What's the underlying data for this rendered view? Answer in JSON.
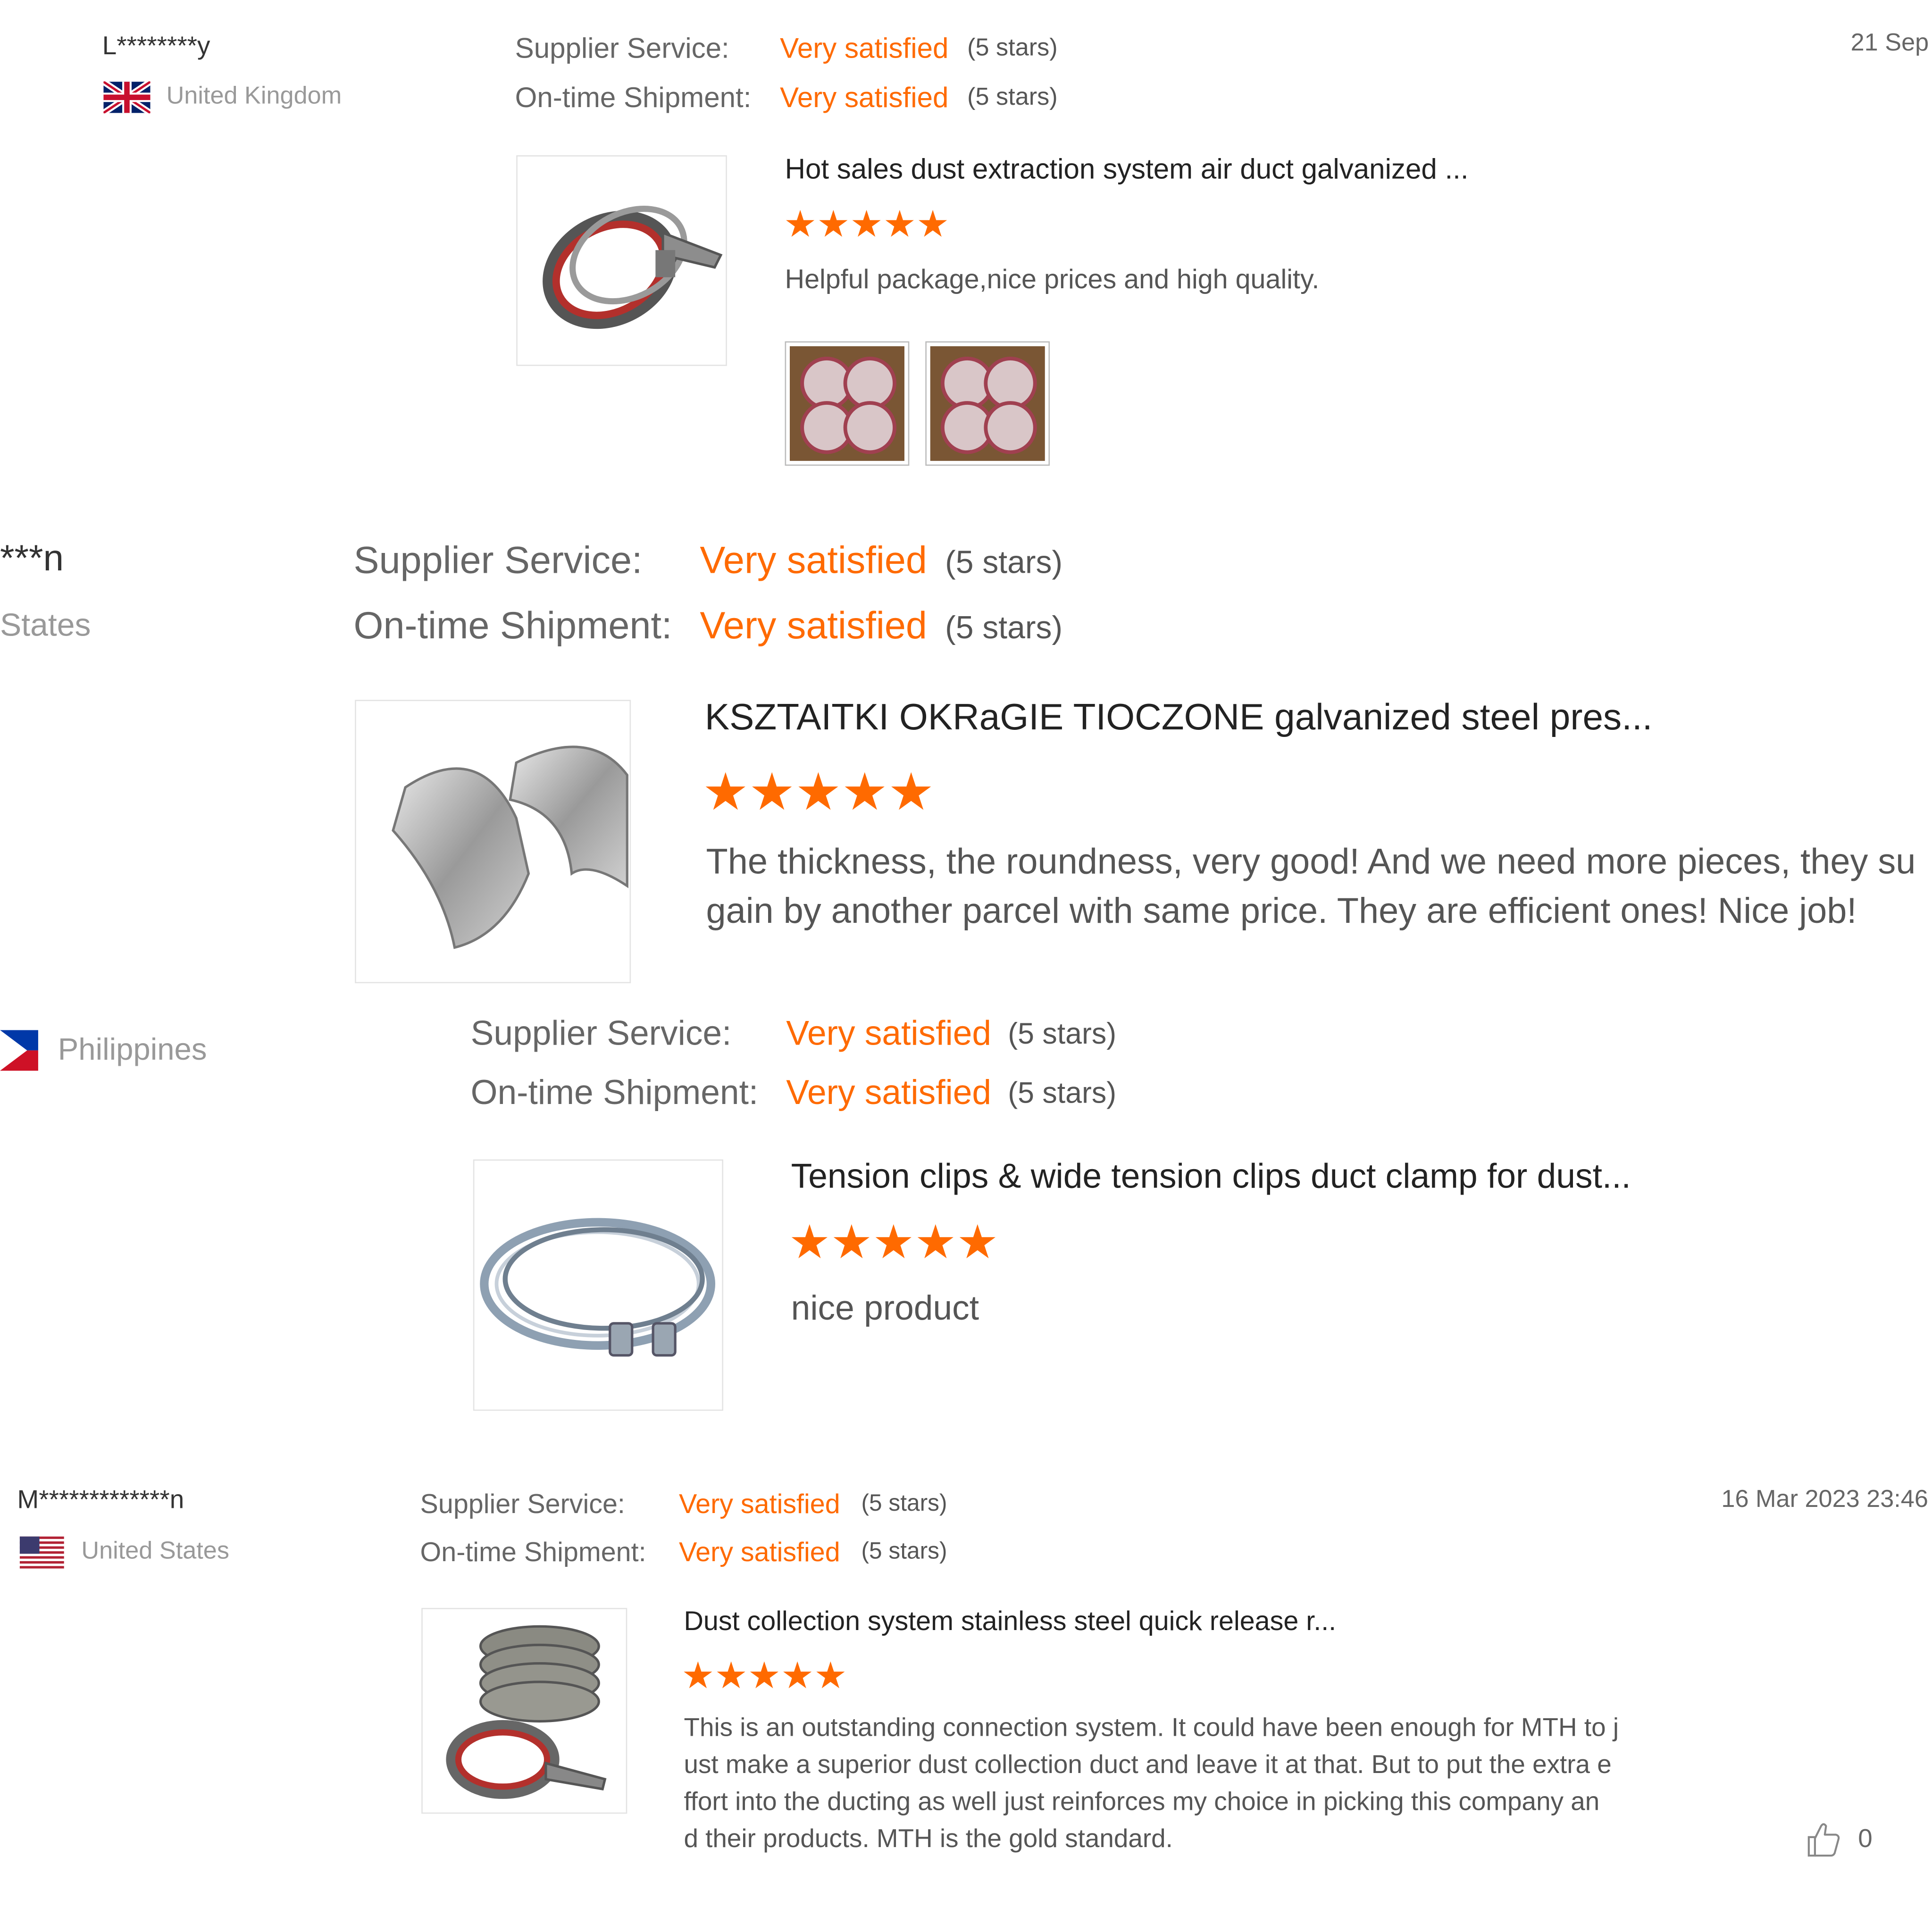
{
  "reviews": [
    {
      "reviewer": "L********y",
      "country": "United Kingdom",
      "date": "21 Sep",
      "supplier_label": "Supplier Service:",
      "supplier_value": "Very satisfied",
      "supplier_stars": "(5 stars)",
      "shipment_label": "On-time Shipment:",
      "shipment_value": "Very satisfied",
      "shipment_stars": "(5 stars)",
      "product_title": "Hot sales dust extraction system air duct galvanized ...",
      "rating": 5,
      "comment": "Helpful package,nice prices and high quality."
    },
    {
      "reviewer": "***n",
      "country": "States",
      "supplier_label": "Supplier Service:",
      "supplier_value": "Very satisfied",
      "supplier_stars": "(5 stars)",
      "shipment_label": "On-time Shipment:",
      "shipment_value": "Very satisfied",
      "shipment_stars": "(5 stars)",
      "product_title": "KSZTAITKI OKRaGIE TIOCZONE galvanized steel pres...",
      "rating": 5,
      "comment_line1": "The thickness, the roundness, very good! And we need more pieces, they su",
      "comment_line2": "gain by another parcel with same price. They are efficient ones! Nice job!"
    },
    {
      "country": "Philippines",
      "supplier_label": "Supplier Service:",
      "supplier_value": "Very satisfied",
      "supplier_stars": "(5 stars)",
      "shipment_label": "On-time Shipment:",
      "shipment_value": "Very satisfied",
      "shipment_stars": "(5 stars)",
      "product_title": "Tension clips & wide tension clips duct clamp for dust...",
      "rating": 5,
      "comment": "nice product"
    },
    {
      "reviewer": "M*************n",
      "country": "United States",
      "date": "16 Mar 2023 23:46",
      "supplier_label": "Supplier Service:",
      "supplier_value": "Very satisfied",
      "supplier_stars": "(5 stars)",
      "shipment_label": "On-time Shipment:",
      "shipment_value": "Very satisfied",
      "shipment_stars": "(5 stars)",
      "product_title": "Dust collection system stainless steel quick release r...",
      "rating": 5,
      "comment_line1": "This is an outstanding connection system. It could have been enough for MTH to j",
      "comment_line2": "ust make a superior dust collection duct and leave it at that. But to put the extra e",
      "comment_line3": "ffort into the ducting as well just reinforces my choice in picking this company an",
      "comment_line4": "d their products. MTH is the gold standard.",
      "like_count": "0"
    }
  ],
  "icons": {
    "star": "star-icon",
    "like": "thumbs-up-icon",
    "flag_uk": "uk-flag-icon",
    "flag_us": "us-flag-icon",
    "flag_ph": "philippines-flag-icon"
  },
  "colors": {
    "accent": "#ff6a00",
    "label": "#666666",
    "muted": "#999999"
  }
}
